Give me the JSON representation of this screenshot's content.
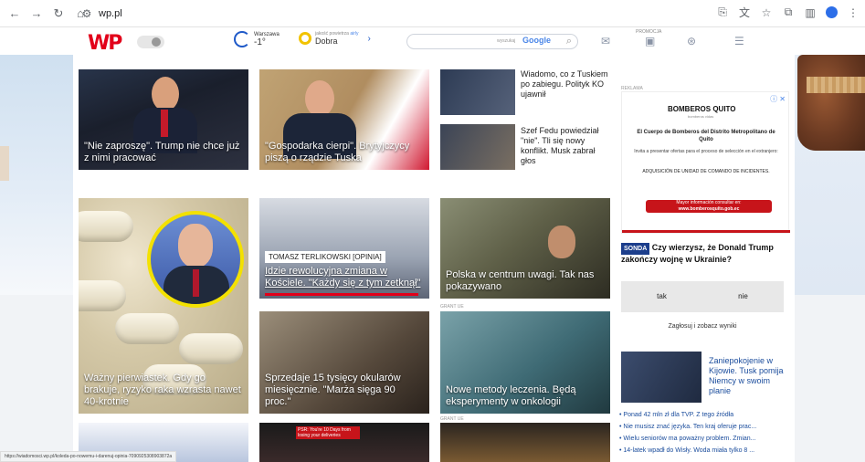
{
  "browser": {
    "url": "wp.pl",
    "status_url": "https://wiadomosci.wp.pl/koleda-po-nowemu-i-darenuj-opinia-7090925308903872a"
  },
  "header": {
    "logo": "WP",
    "weather": {
      "city": "Warszawa",
      "temp": "-1°"
    },
    "air": {
      "label": "jakość powietrza",
      "source": "airly",
      "value": "Dobra"
    },
    "search": {
      "placeholder": "wyszukaj",
      "provider": "Google"
    },
    "promo_label": "PROMOCJA"
  },
  "top_row": [
    {
      "title": "\"Nie zaproszę\". Trump nie chce już z nimi pracować"
    },
    {
      "title": "\"Gospodarka cierpi\". Brytyjczycy piszą o rządzie Tuska"
    }
  ],
  "top_side_news": [
    {
      "title": "Wiadomo, co z Tuskiem po zabiegu. Polityk KO ujawnił"
    },
    {
      "title": "Szef Fedu powiedział \"nie\". Tli się nowy konflikt. Musk zabrał głos"
    }
  ],
  "mid_row": [
    {
      "title": "Ważny pierwiastek. Gdy go brakuje, ryzyko raka wzrasta nawet 40-krotnie"
    },
    {
      "label": "TOMASZ TERLIKOWSKI [OPINIA]",
      "title": "Idzie rewolucyjna zmiana w Kościele. \"Każdy się z tym zetknął\""
    },
    {
      "title": "Polska w centrum uwagi. Tak nas pokazywano"
    },
    {
      "title": "Sprzedaje 15 tysięcy okularów miesięcznie. \"Marża sięga 90 proc.\""
    },
    {
      "grant": "GRANT UE",
      "title": "Nowe metody leczenia. Będą eksperymenty w onkologii"
    }
  ],
  "bottom_grant": "GRANT UE",
  "bottom_thumb_text": "PSR: You're 10 Days from losing your deliveries",
  "ad": {
    "label": "REKLAMA",
    "brand": "BOMBEROS QUITO",
    "brand_sub": "bomberos vidas",
    "line1": "El Cuerpo de Bomberos del Distrito Metropolitano de Quito",
    "line2": "Invita a presentar ofertas para el proceso de selección en el extranjero:",
    "line3": "ADQUISICIÓN DE UNIDAD DE COMANDO DE INCIDENTES.",
    "cta1": "Mayor información consultar en:",
    "cta2": "www.bomberosquito.gob.ec"
  },
  "poll": {
    "badge": "SONDA",
    "question": "Czy wierzysz, że Donald Trump zakończy wojnę w Ukrainie?",
    "options": [
      "tak",
      "nie"
    ],
    "cta": "Zagłosuj i zobacz wyniki"
  },
  "right_news": {
    "title": "Zaniepokojenie w Kijowie. Tusk pomija Niemcy w swoim planie",
    "bullets": [
      "• Ponad 42 mln zł dla TVP. Z tego źródła",
      "• Nie musisz znać języka. Ten kraj oferuje prac...",
      "• Wielu seniorów ma poważny problem. Zmian...",
      "• 14-latek wpadł do Wisły. Woda miała tylko 8 ..."
    ]
  }
}
